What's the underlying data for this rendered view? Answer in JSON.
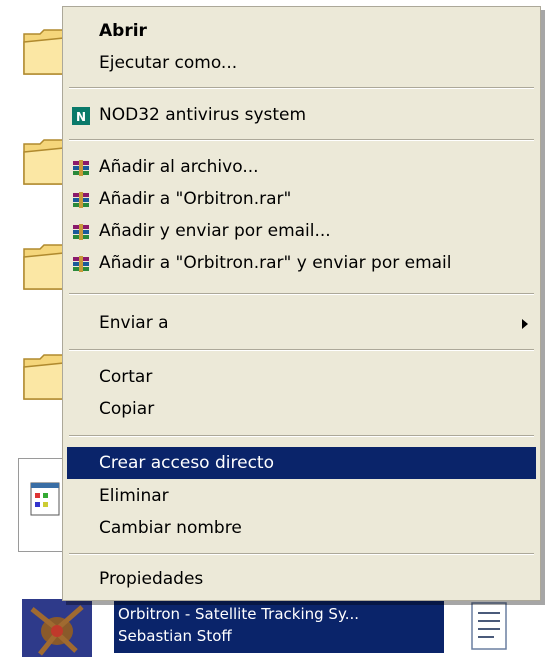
{
  "menu": {
    "open": "Abrir",
    "run_as": "Ejecutar como...",
    "nod32": "NOD32 antivirus system",
    "add_archive": "Añadir al archivo...",
    "add_rar": "Añadir a \"Orbitron.rar\"",
    "add_email": "Añadir y enviar por email...",
    "add_rar_email": "Añadir a \"Orbitron.rar\" y enviar por email",
    "send_to": "Enviar a",
    "cut": "Cortar",
    "copy": "Copiar",
    "create_shortcut": "Crear acceso directo",
    "delete": "Eliminar",
    "rename": "Cambiar nombre",
    "properties": "Propiedades"
  },
  "selected_item": {
    "line1": "Orbitron - Satellite Tracking Sy...",
    "line2": "Sebastian Stoff"
  },
  "colors": {
    "menu_bg": "#ece9d8",
    "highlight": "#0a246a",
    "folder": "#f5d67b"
  },
  "icons": [
    "folder-icon",
    "nod32-icon",
    "winrar-icon",
    "submenu-arrow-icon",
    "orbitron-icon",
    "document-icon"
  ]
}
